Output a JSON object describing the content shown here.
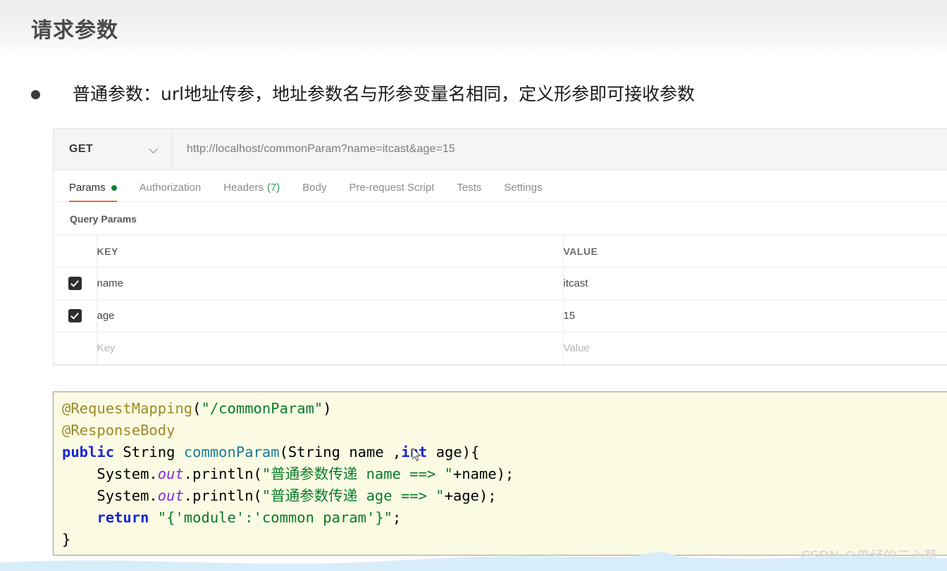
{
  "slide": {
    "title": "请求参数",
    "bullet": "普通参数：url地址传参，地址参数名与形参变量名相同，定义形参即可接收参数",
    "watermark": "CSDN @曾经的三心草"
  },
  "postman": {
    "method": "GET",
    "method_chevron_icon": "chevron-down-icon",
    "url": "http://localhost/commonParam?name=itcast&age=15",
    "tabs": [
      {
        "label": "Params",
        "active": true,
        "dot": true
      },
      {
        "label": "Authorization",
        "active": false,
        "dot": false
      },
      {
        "label": "Headers",
        "active": false,
        "count": "(7)"
      },
      {
        "label": "Body",
        "active": false
      },
      {
        "label": "Pre-request Script",
        "active": false
      },
      {
        "label": "Tests",
        "active": false
      },
      {
        "label": "Settings",
        "active": false
      }
    ],
    "section_title": "Query Params",
    "columns": {
      "key": "KEY",
      "value": "VALUE"
    },
    "rows": [
      {
        "checked": true,
        "key": "name",
        "value": "itcast",
        "placeholder": false
      },
      {
        "checked": true,
        "key": "age",
        "value": "15",
        "placeholder": false
      },
      {
        "checked": false,
        "key": "Key",
        "value": "Value",
        "placeholder": true
      }
    ],
    "colors": {
      "accent_underline": "#e46c2d",
      "status_dot": "#15803d",
      "count_text": "#2a9d5c",
      "checkbox": "#2e2e2e"
    }
  },
  "code": {
    "language": "java",
    "background": "#fbfbe4",
    "lines": [
      [
        {
          "t": "@RequestMapping",
          "c": "anno"
        },
        {
          "t": "(",
          "c": "plain"
        },
        {
          "t": "\"/commonParam\"",
          "c": "str"
        },
        {
          "t": ")",
          "c": "plain"
        }
      ],
      [
        {
          "t": "@ResponseBody",
          "c": "anno"
        }
      ],
      [
        {
          "t": "public",
          "c": "kw"
        },
        {
          "t": " String ",
          "c": "plain"
        },
        {
          "t": "commonParam",
          "c": "fn"
        },
        {
          "t": "(String name ,",
          "c": "plain"
        },
        {
          "t": "int",
          "c": "kw"
        },
        {
          "t": " age){",
          "c": "plain"
        }
      ],
      [
        {
          "t": "    System.",
          "c": "plain"
        },
        {
          "t": "out",
          "c": "field"
        },
        {
          "t": ".println(",
          "c": "plain"
        },
        {
          "t": "\"普通参数传递 name ==> \"",
          "c": "str"
        },
        {
          "t": "+name);",
          "c": "plain"
        }
      ],
      [
        {
          "t": "    System.",
          "c": "plain"
        },
        {
          "t": "out",
          "c": "field"
        },
        {
          "t": ".println(",
          "c": "plain"
        },
        {
          "t": "\"普通参数传递 age ==> \"",
          "c": "str"
        },
        {
          "t": "+age);",
          "c": "plain"
        }
      ],
      [
        {
          "t": "    ",
          "c": "plain"
        },
        {
          "t": "return",
          "c": "kw"
        },
        {
          "t": " ",
          "c": "plain"
        },
        {
          "t": "\"{'module':'common param'}\"",
          "c": "str"
        },
        {
          "t": ";",
          "c": "plain"
        }
      ],
      [
        {
          "t": "}",
          "c": "plain"
        }
      ]
    ]
  }
}
